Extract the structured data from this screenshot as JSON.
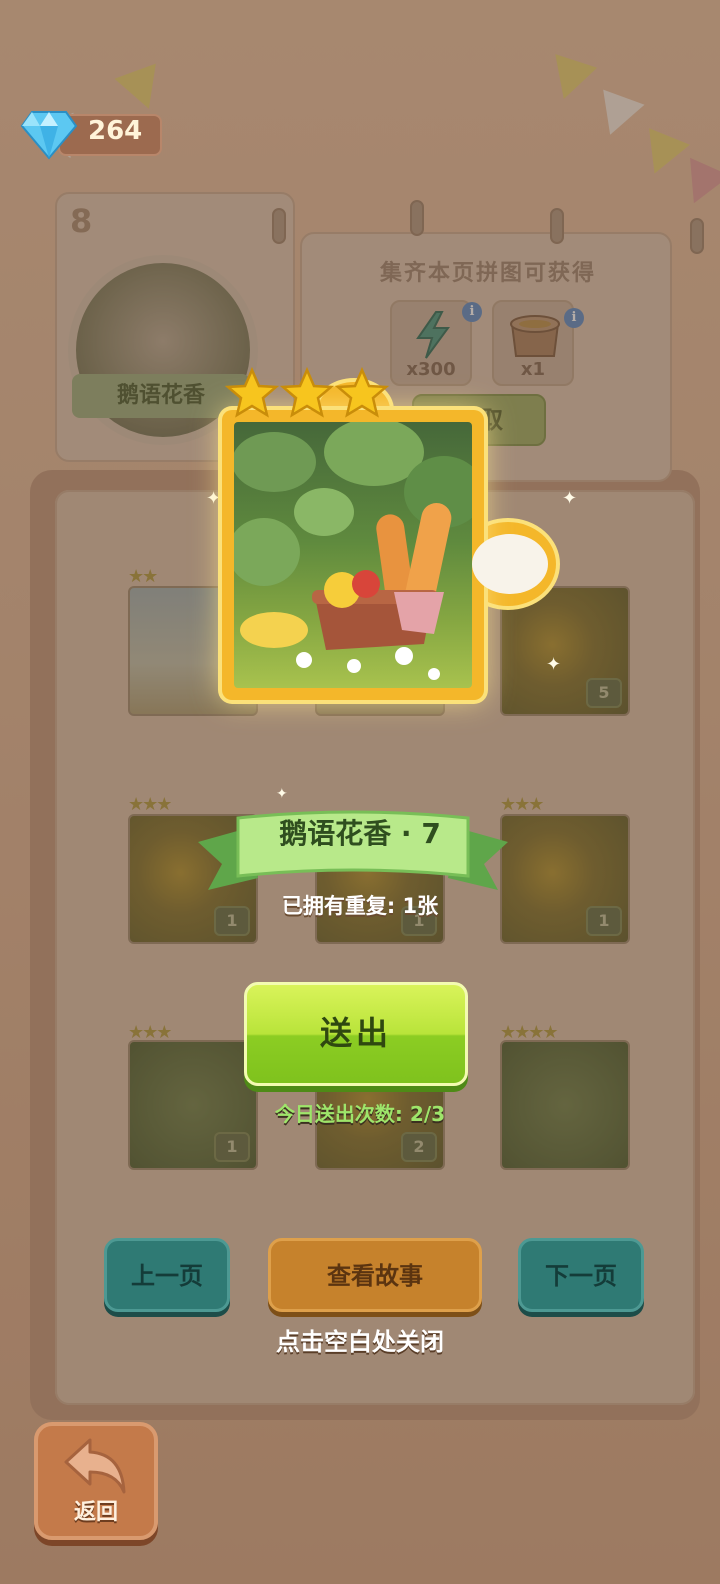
{
  "hud": {
    "gems": "264",
    "gem_icon": "diamond-icon"
  },
  "album_page": {
    "page_number": "8",
    "reward_title": "集齐本页拼图可获得",
    "rewards": [
      {
        "icon": "lightning-energy-icon",
        "count": "x300"
      },
      {
        "icon": "treasure-chest-icon",
        "count": "x1"
      }
    ],
    "claim_label": "领取",
    "medallion_label": "鹅语花香",
    "slot_badges": [
      "5",
      "1",
      "1",
      "1",
      "2"
    ]
  },
  "piece_popup": {
    "stars": 3,
    "title": "鹅语花香 · 7",
    "owned_text": "已拥有重复: 1张",
    "send_label": "送出",
    "send_count": "今日送出次数: 2/3"
  },
  "nav": {
    "prev_label": "上一页",
    "story_label": "查看故事",
    "next_label": "下一页",
    "close_hint": "点击空白处关闭"
  },
  "back": {
    "label": "返回",
    "icon": "back-arrow-icon"
  },
  "colors": {
    "accent_green": "#b9e43a",
    "star_gold": "#f7c51e",
    "teal_button": "#2f7a74",
    "orange_button": "#c6822c"
  }
}
